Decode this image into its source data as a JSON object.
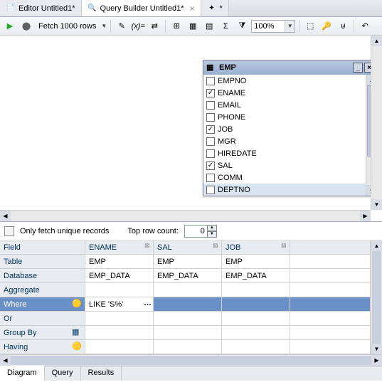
{
  "tabs": [
    {
      "label": "Editor Untitled1*",
      "active": false
    },
    {
      "label": "Query Builder Untitled1*",
      "active": true
    },
    {
      "label": "*",
      "active": false
    }
  ],
  "toolbar": {
    "fetch_label": "Fetch 1000 rows",
    "zoom": "100%"
  },
  "emp_window": {
    "title": "EMP",
    "columns": [
      {
        "name": "EMPNO",
        "checked": false
      },
      {
        "name": "ENAME",
        "checked": true
      },
      {
        "name": "EMAIL",
        "checked": false
      },
      {
        "name": "PHONE",
        "checked": false
      },
      {
        "name": "JOB",
        "checked": true
      },
      {
        "name": "MGR",
        "checked": false
      },
      {
        "name": "HIREDATE",
        "checked": false
      },
      {
        "name": "SAL",
        "checked": true
      },
      {
        "name": "COMM",
        "checked": false
      },
      {
        "name": "DEPTNO",
        "checked": false,
        "selected": true
      }
    ]
  },
  "options": {
    "unique_label": "Only fetch unique records",
    "top_row_label": "Top row count:",
    "top_row_value": "0"
  },
  "grid": {
    "headers": {
      "field": "Field",
      "table": "Table",
      "database": "Database",
      "aggregate": "Aggregate",
      "where": "Where",
      "or": "Or",
      "groupby": "Group By",
      "having": "Having"
    },
    "cols": [
      {
        "field": "ENAME",
        "table": "EMP",
        "database": "EMP_DATA",
        "where": "LIKE 'S%'"
      },
      {
        "field": "SAL",
        "table": "EMP",
        "database": "EMP_DATA",
        "where": ""
      },
      {
        "field": "JOB",
        "table": "EMP",
        "database": "EMP_DATA",
        "where": ""
      }
    ]
  },
  "bottom_tabs": [
    {
      "label": "Diagram",
      "active": true
    },
    {
      "label": "Query",
      "active": false
    },
    {
      "label": "Results",
      "active": false
    }
  ]
}
